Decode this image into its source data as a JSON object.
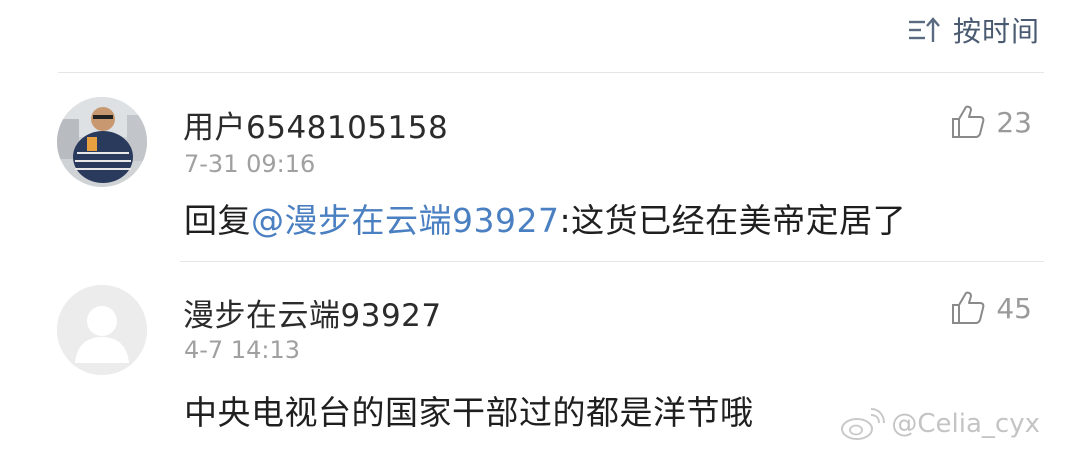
{
  "sort": {
    "label": "按时间",
    "icon": "sort-icon"
  },
  "comments": [
    {
      "username": "用户6548105158",
      "time": "7-31 09:16",
      "text_prefix": "回复",
      "mention": "@漫步在云端93927",
      "text_suffix": ":这货已经在美帝定居了",
      "likes": "23",
      "avatar": "photo-avatar"
    },
    {
      "username": "漫步在云端93927",
      "time": "4-7 14:13",
      "text": "中央电视台的国家干部过的都是洋节哦",
      "likes": "45",
      "avatar": "default-avatar"
    }
  ],
  "watermark": {
    "text": "@Celia_cyx",
    "icon": "weibo-icon"
  },
  "colors": {
    "mention": "#4a7fc1",
    "username": "#2b2b2b",
    "time": "#a0a0a0",
    "sort": "#4a5a70"
  }
}
